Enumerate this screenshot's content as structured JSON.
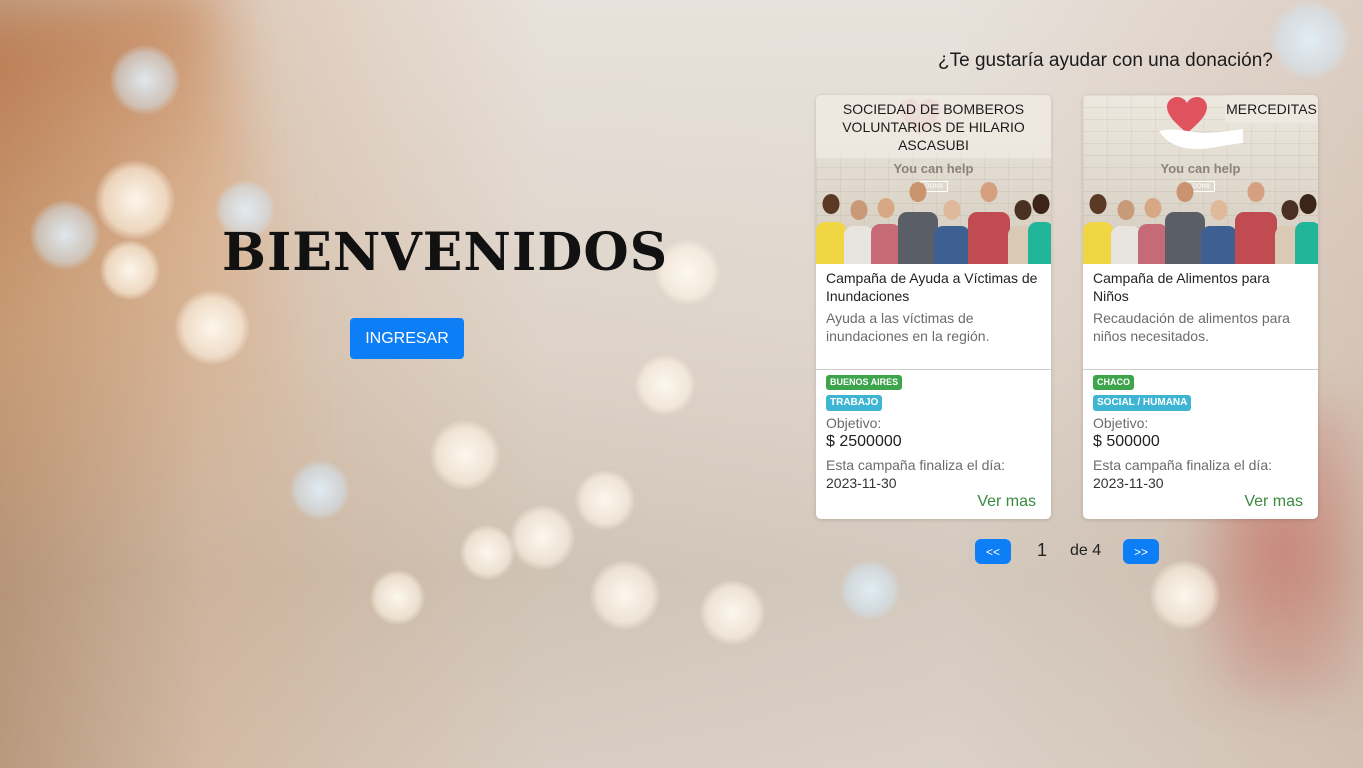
{
  "hero": {
    "title": "BIENVENIDOS",
    "login_label": "INGRESAR"
  },
  "donation_prompt": "¿Te gustaría ayudar con una donación?",
  "image_caption": "You can help",
  "cards": [
    {
      "organization": "SOCIEDAD DE BOMBEROS VOLUNTARIOS DE HILARIO ASCASUBI",
      "title": "Campaña de Ayuda a Víctimas de Inundaciones",
      "description": "Ayuda a las víctimas de inundaciones en la región.",
      "province": "BUENOS AIRES",
      "category": "TRABAJO",
      "goal_label": "Objetivo:",
      "goal_value": "$ 2500000",
      "end_label": "Esta campaña finaliza el día:",
      "end_date": "2023-11-30",
      "see_more": "Ver mas"
    },
    {
      "organization": "MERCEDITAS",
      "title": "Campaña de Alimentos para Niños",
      "description": "Recaudación de alimentos para niños necesitados.",
      "province": "CHACO",
      "category": "SOCIAL / HUMANA",
      "goal_label": "Objetivo:",
      "goal_value": "$ 500000",
      "end_label": "Esta campaña finaliza el día:",
      "end_date": "2023-11-30",
      "see_more": "Ver mas"
    }
  ],
  "pagination": {
    "prev_label": "<<",
    "current_page": "1",
    "total_label": "de 4",
    "next_label": ">>"
  },
  "colors": {
    "primary_button": "#0d7ef5",
    "province_badge": "#3fa54c",
    "category_badge": "#3fb5d4",
    "link_green": "#3a8a3e",
    "heart": "#e0525e"
  }
}
